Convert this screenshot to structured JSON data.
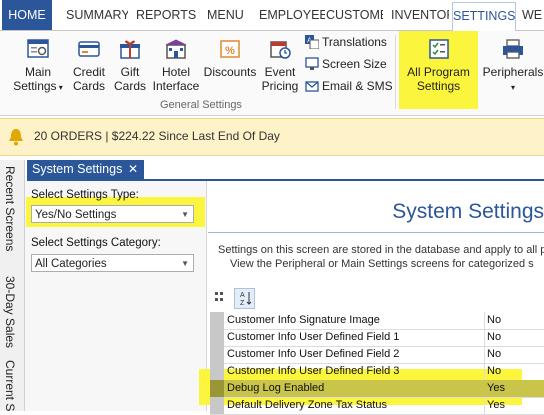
{
  "ribbon_tabs": [
    "HOME",
    "SUMMARY",
    "REPORTS",
    "MENU",
    "EMPLOYEE",
    "CUSTOMER",
    "INVENTOR",
    "SETTINGS",
    "WE"
  ],
  "ribbon_buttons": {
    "main_settings": "Main\nSettings",
    "credit_cards": "Credit\nCards",
    "gift_cards": "Gift\nCards",
    "hotel_interface": "Hotel\nInterface",
    "discounts": "Discounts",
    "event_pricing": "Event\nPricing",
    "translations": "Translations",
    "screen_size": "Screen Size",
    "email_sms": "Email & SMS",
    "all_program_settings": "All Program\nSettings",
    "peripherals": "Peripherals"
  },
  "ribbon_group_label": "General Settings",
  "info_bar": {
    "text": "20 ORDERS | $224.22 Since Last End Of Day"
  },
  "side_tabs": [
    "Recent Screens",
    "30-Day Sales",
    "Current S"
  ],
  "document_tab": "System Settings",
  "left_panel": {
    "settings_type_label": "Select Settings Type:",
    "settings_type_value": "Yes/No Settings",
    "category_label": "Select Settings Category:",
    "category_value": "All Categories"
  },
  "page_title": "System Settings",
  "description": [
    "Settings on this screen are stored in the database and apply to all p",
    "View the Peripheral or Main Settings screens for categorized s"
  ],
  "grid_rows": [
    {
      "name": "Customer Info Signature Image",
      "value": "No"
    },
    {
      "name": "Customer Info User Defined Field 1",
      "value": "No"
    },
    {
      "name": "Customer Info User Defined Field 2",
      "value": "No"
    },
    {
      "name": "Customer Info User Defined Field 3",
      "value": "No"
    },
    {
      "name": "Debug Log Enabled",
      "value": "Yes"
    },
    {
      "name": "Default Delivery Zone Tax Status",
      "value": "Yes"
    }
  ],
  "colors": {
    "accent": "#2b579a",
    "highlight": "#fbf53d",
    "info_bar": "#fdf2c8"
  }
}
